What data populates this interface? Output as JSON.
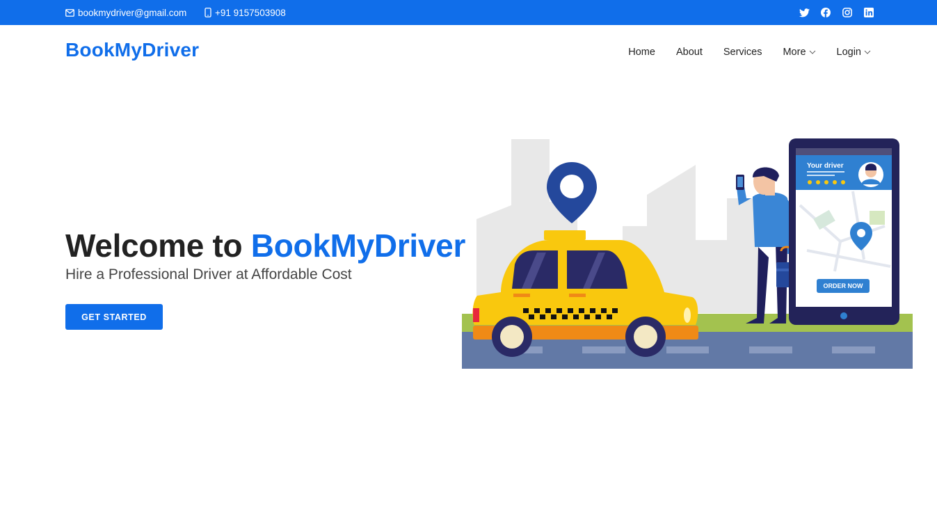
{
  "topbar": {
    "email": "bookmydriver@gmail.com",
    "phone": "+91 9157503908",
    "social_icons": [
      "twitter-icon",
      "facebook-icon",
      "instagram-icon",
      "linkedin-icon"
    ]
  },
  "header": {
    "logo": "BookMyDriver",
    "nav": [
      {
        "label": "Home",
        "dropdown": false
      },
      {
        "label": "About",
        "dropdown": false
      },
      {
        "label": "Services",
        "dropdown": false
      },
      {
        "label": "More",
        "dropdown": true
      },
      {
        "label": "Login",
        "dropdown": true
      }
    ]
  },
  "hero": {
    "title_prefix": "Welcome to ",
    "title_brand": "BookMyDriver",
    "subtitle": "Hire a Professional Driver at Affordable Cost",
    "cta_label": "GET STARTED"
  },
  "illustration": {
    "phone_card_title": "Your driver",
    "phone_button": "ORDER NOW",
    "rating_stars": 5
  },
  "colors": {
    "primary": "#106eea",
    "taxi_yellow": "#f9c80e",
    "dark_navy": "#1f1f5c",
    "road": "#6279a6",
    "grass": "#a3c24f"
  }
}
